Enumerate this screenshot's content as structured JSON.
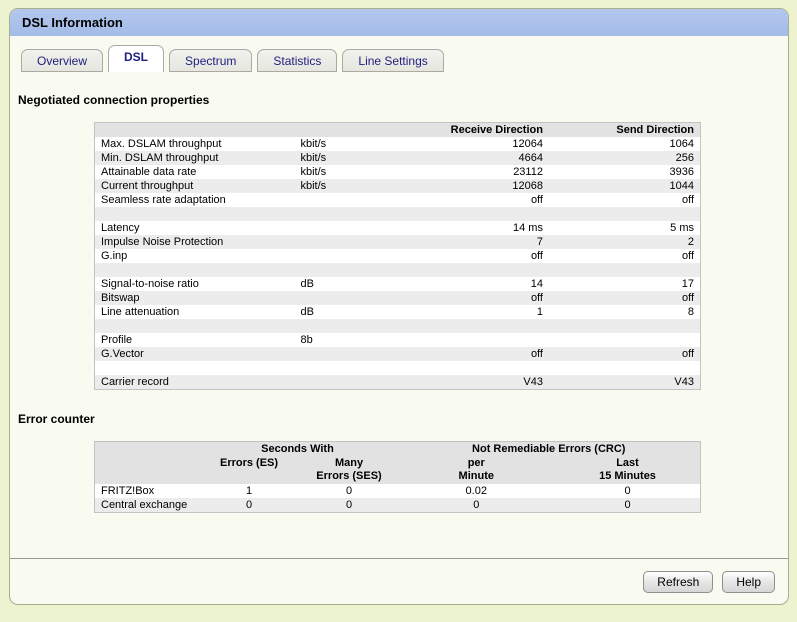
{
  "colors": {
    "page_bg": "#edf2cf",
    "panel_bg": "#f9faf0",
    "panel_border": "#a6b090",
    "titlebar_bg": "#a8bfe8",
    "tab_text": "#202080",
    "table_header_bg": "#e2e2e2",
    "row_stripe_bg": "#ececec"
  },
  "titlebar": {
    "title": "DSL Information"
  },
  "tabs": [
    {
      "label": "Overview"
    },
    {
      "label": "DSL"
    },
    {
      "label": "Spectrum"
    },
    {
      "label": "Statistics"
    },
    {
      "label": "Line Settings"
    }
  ],
  "connection": {
    "heading": "Negotiated connection properties",
    "columns": {
      "receive": "Receive Direction",
      "send": "Send Direction"
    },
    "rows": [
      {
        "label": "Max. DSLAM throughput",
        "unit": "kbit/s",
        "receive": "12064",
        "send": "1064"
      },
      {
        "label": "Min. DSLAM throughput",
        "unit": "kbit/s",
        "receive": "4664",
        "send": "256"
      },
      {
        "label": "Attainable data rate",
        "unit": "kbit/s",
        "receive": "23112",
        "send": "3936"
      },
      {
        "label": "Current throughput",
        "unit": "kbit/s",
        "receive": "12068",
        "send": "1044"
      },
      {
        "label": "Seamless rate adaptation",
        "unit": "",
        "receive": "off",
        "send": "off"
      },
      {
        "label": "",
        "unit": "",
        "receive": "",
        "send": ""
      },
      {
        "label": "Latency",
        "unit": "",
        "receive": "14 ms",
        "send": "5 ms"
      },
      {
        "label": "Impulse Noise Protection",
        "unit": "",
        "receive": "7",
        "send": "2"
      },
      {
        "label": "G.inp",
        "unit": "",
        "receive": "off",
        "send": "off"
      },
      {
        "label": "",
        "unit": "",
        "receive": "",
        "send": ""
      },
      {
        "label": "Signal-to-noise ratio",
        "unit": "dB",
        "receive": "14",
        "send": "17"
      },
      {
        "label": "Bitswap",
        "unit": "",
        "receive": "off",
        "send": "off"
      },
      {
        "label": "Line attenuation",
        "unit": "dB",
        "receive": "1",
        "send": "8"
      },
      {
        "label": "",
        "unit": "",
        "receive": "",
        "send": ""
      },
      {
        "label": "Profile",
        "unit": "8b",
        "receive": "",
        "send": ""
      },
      {
        "label": "G.Vector",
        "unit": "",
        "receive": "off",
        "send": "off"
      },
      {
        "label": "",
        "unit": "",
        "receive": "",
        "send": ""
      },
      {
        "label": "Carrier record",
        "unit": "",
        "receive": "V43",
        "send": "V43"
      }
    ]
  },
  "errors": {
    "heading": "Error counter",
    "groups": {
      "seconds": "Seconds With",
      "crc": "Not Remediable Errors (CRC)"
    },
    "columns": [
      {
        "line1": "Errors (ES)",
        "line2": ""
      },
      {
        "line1": "Many",
        "line2": "Errors (SES)"
      },
      {
        "line1": "per",
        "line2": "Minute"
      },
      {
        "line1": "Last",
        "line2": "15 Minutes"
      }
    ],
    "rows": [
      {
        "label": "FRITZ!Box",
        "es": "1",
        "ses": "0",
        "per_minute": "0.02",
        "last_15": "0"
      },
      {
        "label": "Central exchange",
        "es": "0",
        "ses": "0",
        "per_minute": "0",
        "last_15": "0"
      }
    ]
  },
  "footer": {
    "refresh": "Refresh",
    "help": "Help"
  }
}
